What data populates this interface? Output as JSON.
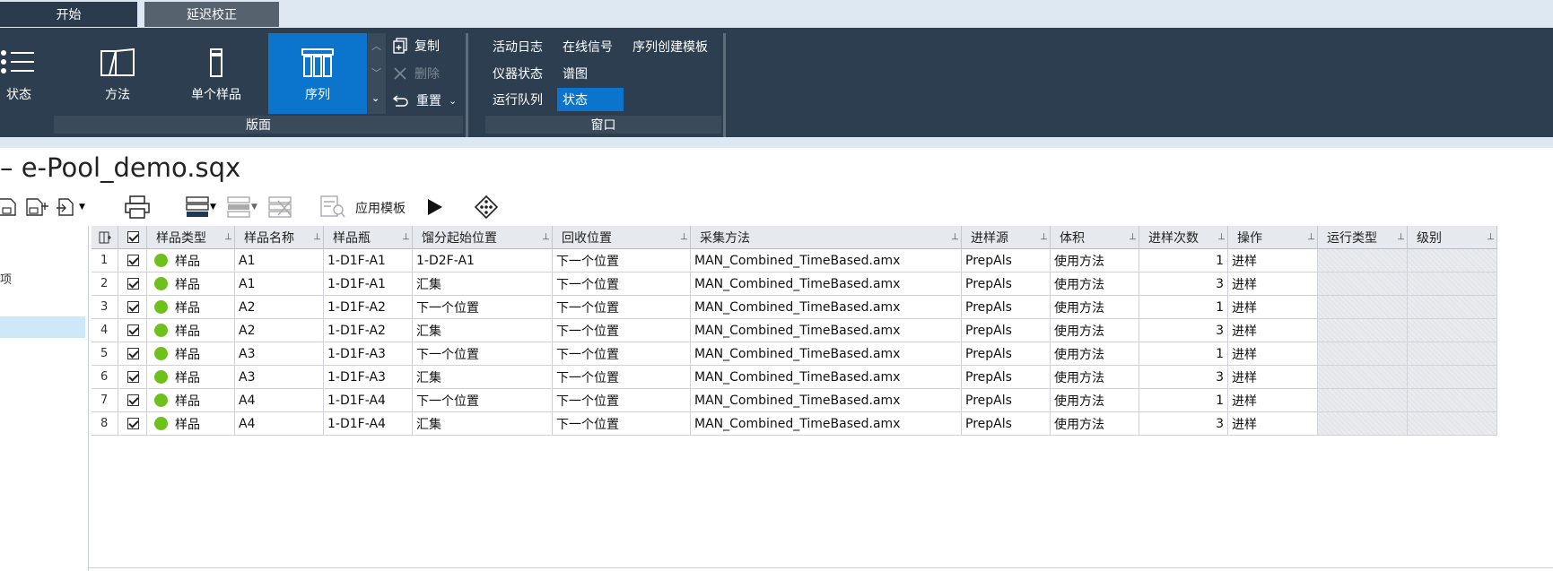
{
  "tabs": [
    {
      "label": "开始"
    },
    {
      "label": "延迟校正"
    }
  ],
  "ribbon": {
    "big_buttons": [
      {
        "label": "状态",
        "icon": "status-list-icon"
      },
      {
        "label": "方法",
        "icon": "book-icon"
      },
      {
        "label": "单个样品",
        "icon": "vial-icon"
      },
      {
        "label": "序列",
        "icon": "sequence-vials-icon",
        "active": true
      }
    ],
    "edit": {
      "copy_label": "复制",
      "delete_label": "删除",
      "reset_label": "重置"
    },
    "group_layout_label": "版面",
    "window_items": {
      "activity_log": "活动日志",
      "online_signal": "在线信号",
      "sequence_template": "序列创建模板",
      "instrument_status": "仪器状态",
      "spectrum": "谱图",
      "run_queue": "运行队列",
      "status": "状态"
    },
    "group_window_label": "窗口"
  },
  "document": {
    "title": "– e-Pool_demo.sqx",
    "apply_template_label": "应用模板"
  },
  "left_panel": {
    "item_label": "项"
  },
  "table": {
    "headers": [
      "样品类型",
      "样品名称",
      "样品瓶",
      "馏分起始位置",
      "回收位置",
      "采集方法",
      "进样源",
      "体积",
      "进样次数",
      "操作",
      "运行类型",
      "级别"
    ],
    "rows": [
      {
        "n": "1",
        "type": "样品",
        "name": "A1",
        "vial": "1-D1F-A1",
        "frac": "1-D2F-A1",
        "recov": "下一个位置",
        "method": "MAN_Combined_TimeBased.amx",
        "source": "PrepAls",
        "vol": "使用方法",
        "inj": "1",
        "op": "进样"
      },
      {
        "n": "2",
        "type": "样品",
        "name": "A1",
        "vial": "1-D1F-A1",
        "frac": "汇集",
        "recov": "下一个位置",
        "method": "MAN_Combined_TimeBased.amx",
        "source": "PrepAls",
        "vol": "使用方法",
        "inj": "3",
        "op": "进样"
      },
      {
        "n": "3",
        "type": "样品",
        "name": "A2",
        "vial": "1-D1F-A2",
        "frac": "下一个位置",
        "recov": "下一个位置",
        "method": "MAN_Combined_TimeBased.amx",
        "source": "PrepAls",
        "vol": "使用方法",
        "inj": "1",
        "op": "进样"
      },
      {
        "n": "4",
        "type": "样品",
        "name": "A2",
        "vial": "1-D1F-A2",
        "frac": "汇集",
        "recov": "下一个位置",
        "method": "MAN_Combined_TimeBased.amx",
        "source": "PrepAls",
        "vol": "使用方法",
        "inj": "3",
        "op": "进样"
      },
      {
        "n": "5",
        "type": "样品",
        "name": "A3",
        "vial": "1-D1F-A3",
        "frac": "下一个位置",
        "recov": "下一个位置",
        "method": "MAN_Combined_TimeBased.amx",
        "source": "PrepAls",
        "vol": "使用方法",
        "inj": "1",
        "op": "进样"
      },
      {
        "n": "6",
        "type": "样品",
        "name": "A3",
        "vial": "1-D1F-A3",
        "frac": "汇集",
        "recov": "下一个位置",
        "method": "MAN_Combined_TimeBased.amx",
        "source": "PrepAls",
        "vol": "使用方法",
        "inj": "3",
        "op": "进样"
      },
      {
        "n": "7",
        "type": "样品",
        "name": "A4",
        "vial": "1-D1F-A4",
        "frac": "下一个位置",
        "recov": "下一个位置",
        "method": "MAN_Combined_TimeBased.amx",
        "source": "PrepAls",
        "vol": "使用方法",
        "inj": "1",
        "op": "进样"
      },
      {
        "n": "8",
        "type": "样品",
        "name": "A4",
        "vial": "1-D1F-A4",
        "frac": "汇集",
        "recov": "下一个位置",
        "method": "MAN_Combined_TimeBased.amx",
        "source": "PrepAls",
        "vol": "使用方法",
        "inj": "3",
        "op": "进样"
      }
    ]
  },
  "colors": {
    "ribbon_bg": "#2d3e50",
    "accent": "#0b74cd",
    "status_dot": "#6cc21b",
    "selection": "#cde8f8"
  }
}
